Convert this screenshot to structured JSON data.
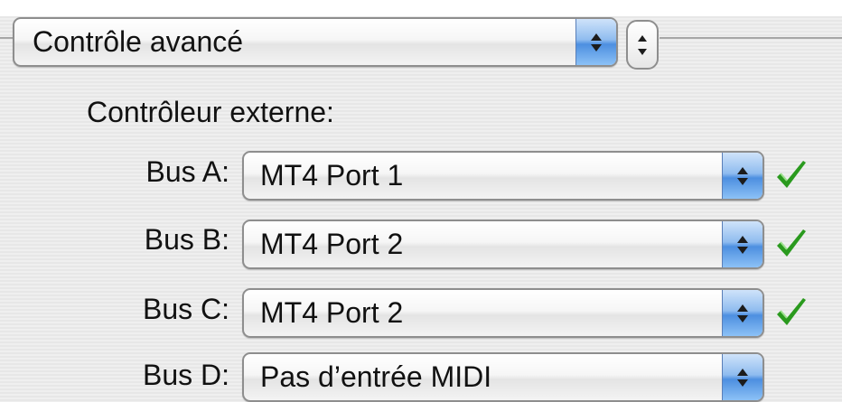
{
  "advanced_section": {
    "selected": "Contrôle avancé"
  },
  "external_controller": {
    "heading": "Contrôleur externe:",
    "buses": [
      {
        "label": "Bus A:",
        "value": "MT4 Port 1",
        "status_icon": "checkmark-icon",
        "status_color": "#2a9a1e"
      },
      {
        "label": "Bus B:",
        "value": "MT4 Port 2",
        "status_icon": "checkmark-icon",
        "status_color": "#2a9a1e"
      },
      {
        "label": "Bus C:",
        "value": "MT4 Port 2",
        "status_icon": "checkmark-icon",
        "status_color": "#2a9a1e"
      },
      {
        "label": "Bus D:",
        "value": "Pas d’entrée MIDI",
        "status_icon": null
      }
    ]
  },
  "colors": {
    "accent": "#4d8fe0",
    "check": "#2a9a1e"
  }
}
